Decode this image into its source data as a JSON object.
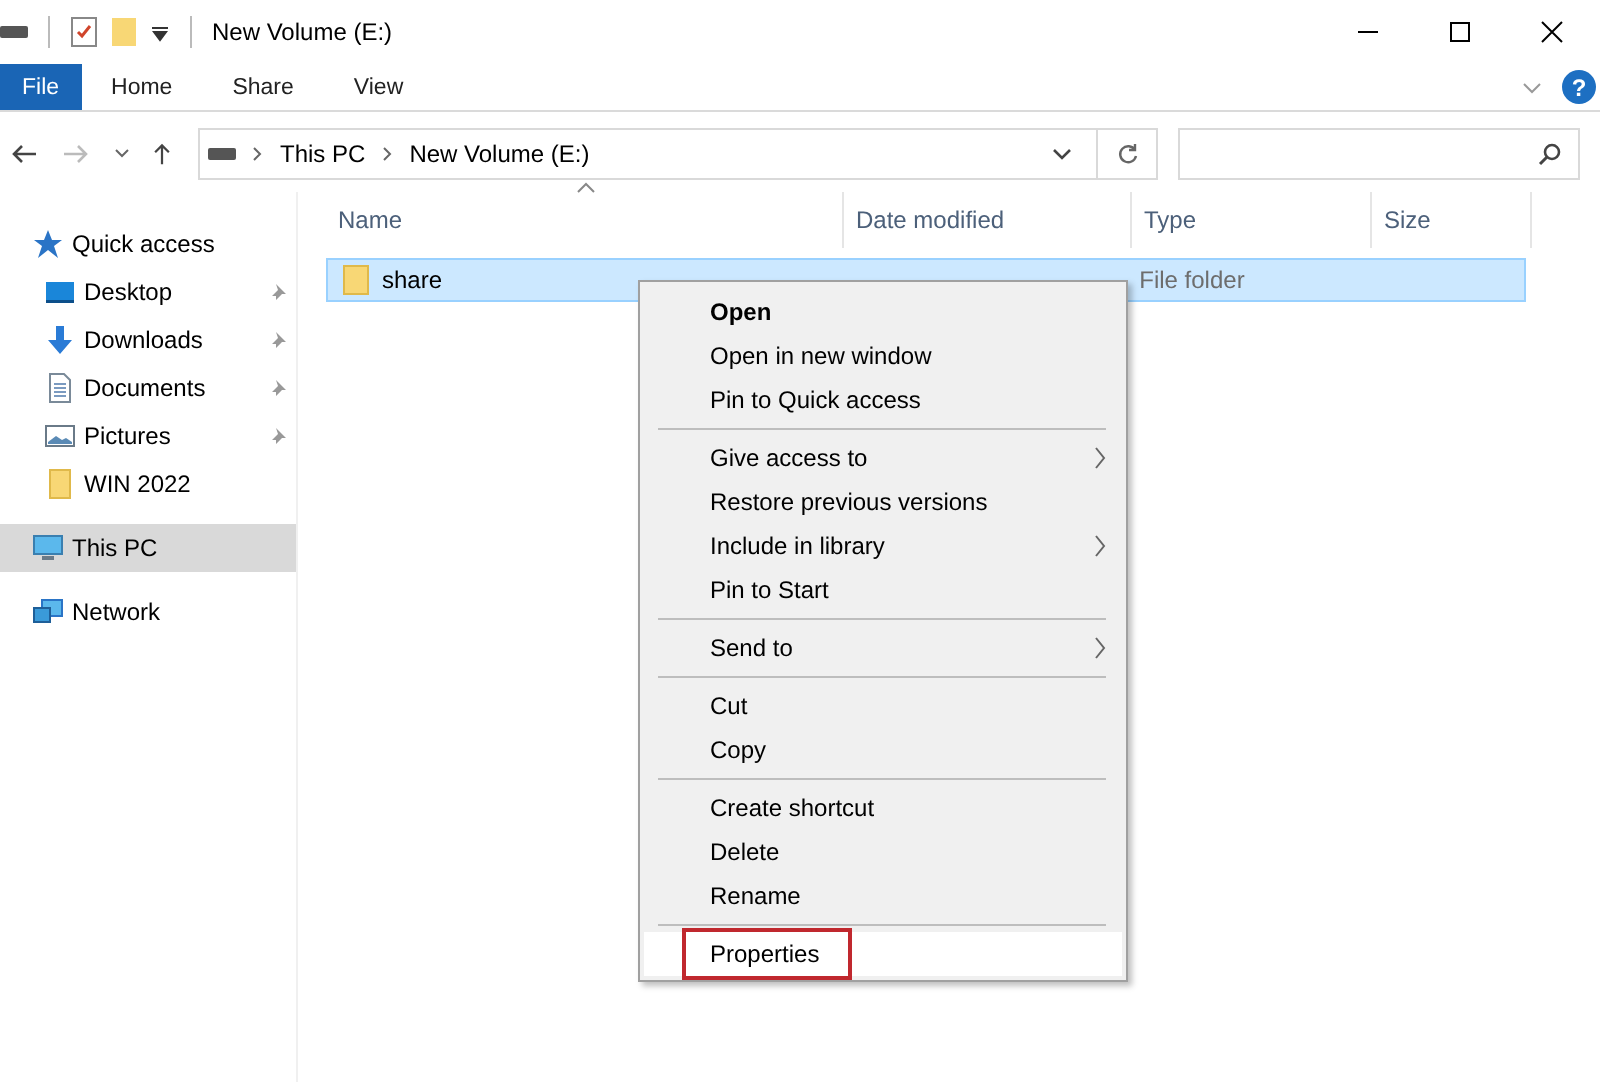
{
  "window": {
    "title": "New Volume (E:)"
  },
  "ribbon": {
    "tabs": [
      {
        "label": "File",
        "selected": true
      },
      {
        "label": "Home",
        "selected": false
      },
      {
        "label": "Share",
        "selected": false
      },
      {
        "label": "View",
        "selected": false
      }
    ],
    "help": "?"
  },
  "address_bar": {
    "path": [
      "This PC",
      "New Volume (E:)"
    ]
  },
  "sidebar": {
    "items": [
      {
        "label": "Quick access",
        "kind": "star",
        "pinned": false,
        "selected": false,
        "children": [
          {
            "label": "Desktop",
            "kind": "desktop",
            "pinned": true,
            "selected": false
          },
          {
            "label": "Downloads",
            "kind": "download",
            "pinned": true,
            "selected": false
          },
          {
            "label": "Documents",
            "kind": "document",
            "pinned": true,
            "selected": false
          },
          {
            "label": "Pictures",
            "kind": "pictures",
            "pinned": true,
            "selected": false
          },
          {
            "label": "WIN 2022",
            "kind": "folder",
            "pinned": false,
            "selected": false
          }
        ]
      },
      {
        "label": "This PC",
        "kind": "pc",
        "pinned": false,
        "selected": true
      },
      {
        "label": "Network",
        "kind": "network",
        "pinned": false,
        "selected": false
      }
    ]
  },
  "table": {
    "columns": [
      "Name",
      "Date modified",
      "Type",
      "Size"
    ],
    "rows": [
      {
        "name": "share",
        "type": "File folder",
        "selected": true
      }
    ]
  },
  "context_menu": {
    "items": [
      {
        "kind": "item",
        "label": "Open",
        "default": true,
        "submenu": false,
        "selected": false,
        "outlined": false
      },
      {
        "kind": "item",
        "label": "Open in new window",
        "default": false,
        "submenu": false,
        "selected": false,
        "outlined": false
      },
      {
        "kind": "item",
        "label": "Pin to Quick access",
        "default": false,
        "submenu": false,
        "selected": false,
        "outlined": false
      },
      {
        "kind": "separator"
      },
      {
        "kind": "item",
        "label": "Give access to",
        "default": false,
        "submenu": true,
        "selected": false,
        "outlined": false
      },
      {
        "kind": "item",
        "label": "Restore previous versions",
        "default": false,
        "submenu": false,
        "selected": false,
        "outlined": false
      },
      {
        "kind": "item",
        "label": "Include in library",
        "default": false,
        "submenu": true,
        "selected": false,
        "outlined": false
      },
      {
        "kind": "item",
        "label": "Pin to Start",
        "default": false,
        "submenu": false,
        "selected": false,
        "outlined": false
      },
      {
        "kind": "separator"
      },
      {
        "kind": "item",
        "label": "Send to",
        "default": false,
        "submenu": true,
        "selected": false,
        "outlined": false
      },
      {
        "kind": "separator"
      },
      {
        "kind": "item",
        "label": "Cut",
        "default": false,
        "submenu": false,
        "selected": false,
        "outlined": false
      },
      {
        "kind": "item",
        "label": "Copy",
        "default": false,
        "submenu": false,
        "selected": false,
        "outlined": false
      },
      {
        "kind": "separator"
      },
      {
        "kind": "item",
        "label": "Create shortcut",
        "default": false,
        "submenu": false,
        "selected": false,
        "outlined": false
      },
      {
        "kind": "item",
        "label": "Delete",
        "default": false,
        "submenu": false,
        "selected": false,
        "outlined": false
      },
      {
        "kind": "item",
        "label": "Rename",
        "default": false,
        "submenu": false,
        "selected": false,
        "outlined": false
      },
      {
        "kind": "separator"
      },
      {
        "kind": "item",
        "label": "Properties",
        "default": false,
        "submenu": false,
        "selected": true,
        "outlined": true
      }
    ]
  }
}
